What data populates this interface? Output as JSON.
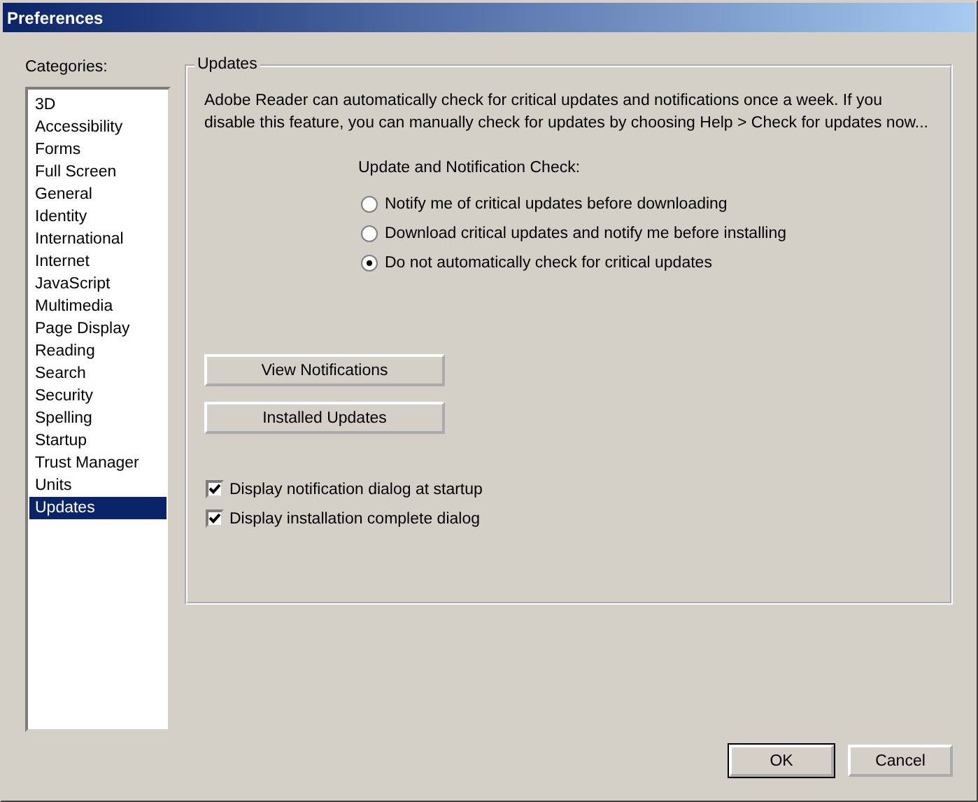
{
  "window": {
    "title": "Preferences"
  },
  "sidebar": {
    "label": "Categories:",
    "items": [
      {
        "label": "3D",
        "selected": false
      },
      {
        "label": "Accessibility",
        "selected": false
      },
      {
        "label": "Forms",
        "selected": false
      },
      {
        "label": "Full Screen",
        "selected": false
      },
      {
        "label": "General",
        "selected": false
      },
      {
        "label": "Identity",
        "selected": false
      },
      {
        "label": "International",
        "selected": false
      },
      {
        "label": "Internet",
        "selected": false
      },
      {
        "label": "JavaScript",
        "selected": false
      },
      {
        "label": "Multimedia",
        "selected": false
      },
      {
        "label": "Page Display",
        "selected": false
      },
      {
        "label": "Reading",
        "selected": false
      },
      {
        "label": "Search",
        "selected": false
      },
      {
        "label": "Security",
        "selected": false
      },
      {
        "label": "Spelling",
        "selected": false
      },
      {
        "label": "Startup",
        "selected": false
      },
      {
        "label": "Trust Manager",
        "selected": false
      },
      {
        "label": "Units",
        "selected": false
      },
      {
        "label": "Updates",
        "selected": true
      }
    ]
  },
  "group": {
    "title": "Updates",
    "description": "Adobe Reader can automatically check for critical updates and notifications once a week. If you disable this feature, you can manually check for updates by choosing Help > Check for updates now...",
    "radio_label": "Update and Notification Check:",
    "radios": [
      {
        "label": "Notify me of critical updates before downloading",
        "selected": false
      },
      {
        "label": "Download critical updates and notify me before installing",
        "selected": false
      },
      {
        "label": "Do not automatically check for critical updates",
        "selected": true
      }
    ],
    "buttons": [
      "View Notifications",
      "Installed Updates"
    ],
    "checkboxes": [
      {
        "label": "Display notification dialog at startup",
        "checked": true
      },
      {
        "label": "Display installation complete dialog",
        "checked": true
      }
    ]
  },
  "buttons": [
    "OK",
    "Cancel"
  ]
}
